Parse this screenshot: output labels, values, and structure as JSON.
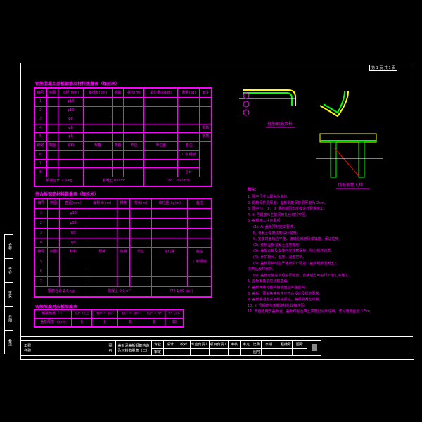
{
  "sheet": {
    "label": "第 1 页 共 1 页"
  },
  "table1": {
    "title": "钢筋混凝土盖板钢筋及材料数量表（每延米）",
    "headers": [
      "编号",
      "简图",
      "直径(mm)",
      "每根长(cm)",
      "根数",
      "共长(m)",
      "单位重(kg/m)",
      "重量(kg)",
      "备注"
    ],
    "rows": [
      [
        "1",
        "",
        "φ10",
        "",
        "",
        "",
        "",
        "",
        ""
      ],
      [
        "2",
        "",
        "φ10",
        "",
        "",
        "",
        "",
        "",
        ""
      ],
      [
        "3",
        "",
        "φ8",
        "",
        "",
        "",
        "",
        "",
        ""
      ],
      [
        "4",
        "",
        "φ8",
        "",
        "",
        "",
        "",
        "",
        "钢筋"
      ],
      [
        "5",
        "",
        "φ8",
        "",
        "",
        "",
        "",
        "",
        "钢筋"
      ]
    ],
    "headers2": [
      "编号",
      "简图",
      "材料",
      "规格",
      "数量",
      "单位",
      "单位量",
      "备注"
    ],
    "rows2": [
      [
        "6",
        "",
        "",
        "",
        "",
        "",
        "",
        "厂制钢板"
      ],
      [
        "7",
        "",
        "",
        "",
        "",
        "",
        "",
        ""
      ],
      [
        "8",
        "",
        "",
        "",
        "",
        "",
        "",
        "合计"
      ]
    ],
    "footer": [
      "钢筋合计 2.6 kg",
      "混凝土 0.0 m³",
      "??? 1.00 (m³)"
    ]
  },
  "table2": {
    "title": "拼合板钢筋材料数量表（每延米）",
    "headers": [
      "编号",
      "简图",
      "直径(mm)",
      "每根长(cm)",
      "根数",
      "共长(m)",
      "单位重(kg/m)",
      "备注"
    ],
    "rows": [
      [
        "1",
        "",
        "φ10",
        "",
        "",
        "",
        "",
        ""
      ],
      [
        "2",
        "",
        "φ10",
        "",
        "",
        "",
        "",
        ""
      ],
      [
        "3",
        "",
        "φ8",
        "",
        "",
        "",
        "",
        ""
      ],
      [
        "4",
        "",
        "φ8",
        "",
        "",
        "",
        "",
        ""
      ]
    ],
    "headers2": [
      "编号",
      "简图",
      "材料",
      "规格",
      "数量",
      "单位",
      "单位量",
      "备注"
    ],
    "rows2": [
      [
        "5",
        "",
        "",
        "",
        "",
        "",
        "",
        "厂制钢板"
      ],
      [
        "6",
        "",
        "",
        "",
        "",
        "",
        "",
        ""
      ],
      [
        "7",
        "",
        "",
        "",
        "",
        "",
        "",
        ""
      ]
    ],
    "footer": [
      "钢筋合计 2.6 kg",
      "混凝土 0.0 m³",
      "??? 1.00 (m³)"
    ]
  },
  "table3": {
    "title": "各级坡度对应板厚度表",
    "row1": [
      "坡度角度（°）",
      "30° 以上",
      "30° ~ 15°",
      "15° ~ 10°",
      "10° ~ 5°",
      "5° 以下"
    ],
    "row2": [
      "盖板厚度 h(cm)",
      "8",
      "8",
      "8",
      "8",
      "10"
    ]
  },
  "details": {
    "detail1_title": "箍筋钢筋大样",
    "detail2_title": "顶板钢筋大样",
    "markers": [
      "①",
      "②",
      "③",
      "④",
      "⑤",
      "⑥"
    ]
  },
  "notes": {
    "heading": "附注：",
    "lines": [
      "1. 图中尺寸以厘米为单位。",
      "2. 钢筋保护层厚度：盖板钢筋保护层厚度为 2cm。",
      "3. 图中 ①、②、③ 钢筋锚固长度按设计要求施工。",
      "4. ④ 号钢筋与主筋间用扎丝绑扎牢固。",
      "5. 盖板施工注意事项：",
      "(1). A. 盖板预制施工要求；",
      "B. 混凝土强度达到设计强度；",
      "C. 安装时盖板应平整，接缝处采用砂浆填塞，保证密实。",
      "(2). 预制盖板混凝土强度等级：",
      "(3). 盖板运输及安装时应注意保护，防止损坏边角。",
      "(4). 养护期间、温度、湿度控制。",
      "(5). 盖板预制时应严格按设计配筋（盖板钢筋混凝土），",
      "浇筑后及时养护。",
      "(6). 盖板安装完毕后进行检查，合格后方可进行下道工序施工。",
      "6. 盖板安装前应清理基础。",
      "7. 盖板两端与基础接触面应平整密实。",
      "8. 盖板、预制块等构件应符合设计及规范要求。",
      "9. 盖板混凝土采用机械振捣，确保混凝土质量。",
      "10. ① 号钢筋与主筋连接处焊接牢固。",
      "11. 本图适用于盖板涵，盖板跨径及填土高度见设计说明，详见通用图纸 1.5m。"
    ]
  },
  "titleblock": {
    "left": [
      "工程",
      "名称"
    ],
    "figure_label": [
      "图",
      "名"
    ],
    "figure_name": [
      "盖板涵盖板钢筋构造",
      "及材料数量表（二）"
    ],
    "cells": [
      "专业",
      "设计",
      "校对",
      "专业负责人",
      "项目负责人",
      "审核",
      "审定",
      "比例",
      "日期",
      "工程编号",
      "图号"
    ],
    "cells2": [
      "审定",
      "",
      "",
      "",
      "",
      "",
      "",
      "图号",
      ""
    ],
    "logo": "logo"
  },
  "side": [
    "会签",
    "专业",
    "签名",
    "日期",
    "备注"
  ]
}
